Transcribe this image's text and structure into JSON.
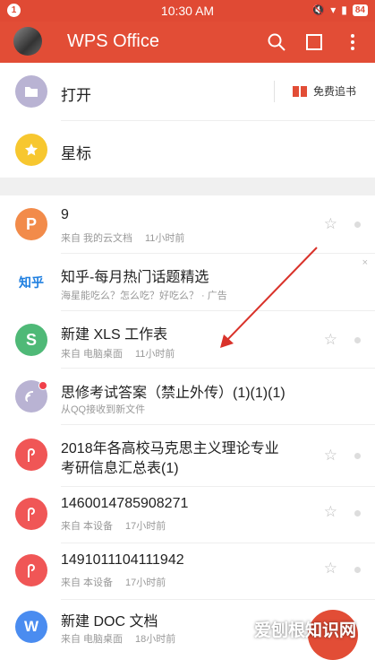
{
  "status_bar": {
    "notification_count": "1",
    "time": "10:30 AM",
    "battery": "84"
  },
  "header": {
    "title": "WPS Office"
  },
  "quick": {
    "open_label": "打开",
    "free_reading_label": "免费追书",
    "starred_label": "星标"
  },
  "files": [
    {
      "title": "9",
      "subtitle": "来自 我的云文档",
      "time": "11小时前",
      "icon_letter": "P",
      "color": "#f28b4a"
    },
    {
      "title": "知乎-每月热门话题精选",
      "subtitle": "海星能吃么？怎么吃？好吃么？ · 广告",
      "badge": "知乎"
    },
    {
      "title": "新建 XLS 工作表",
      "subtitle": "来自 电脑桌面",
      "time": "11小时前",
      "icon_letter": "S",
      "color": "#4fb977"
    },
    {
      "title": "思修考试答案（禁止外传）(1)(1)(1)",
      "subtitle": "从QQ接收到新文件"
    },
    {
      "title_line1": "2018年各高校马克思主义理论专业",
      "title_line2": "考研信息汇总表(1)"
    },
    {
      "title": "1460014785908271",
      "subtitle": "来自 本设备",
      "time": "17小时前"
    },
    {
      "title": "1491011104111942",
      "subtitle": "来自 本设备",
      "time": "17小时前"
    },
    {
      "title": "新建 DOC 文档",
      "subtitle": "来自 电脑桌面",
      "time": "18小时前",
      "icon_letter": "W",
      "color": "#4a8cf0"
    }
  ],
  "watermark": "爱刨根知识网",
  "colors": {
    "brand": "#e24d36",
    "folder": "#b9b3d3",
    "star_circle": "#f7c72f",
    "pdf": "#f05656",
    "arrow": "#d9322a"
  }
}
